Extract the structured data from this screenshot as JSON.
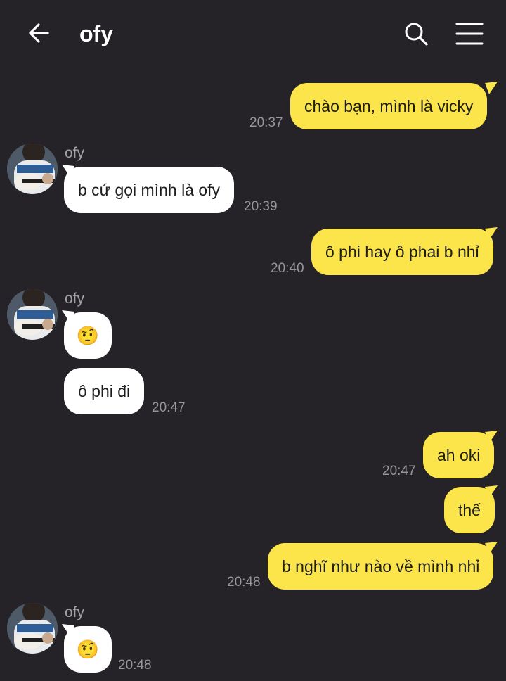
{
  "header": {
    "title": "ofy",
    "back_icon": "arrow-left-icon",
    "search_icon": "search-icon",
    "menu_icon": "hamburger-menu-icon"
  },
  "colors": {
    "background": "#262328",
    "outgoing_bubble": "#fbe54a",
    "incoming_bubble": "#ffffff",
    "timestamp": "#98969b"
  },
  "messages": [
    {
      "direction": "out",
      "text": "chào bạn, mình là vicky",
      "time": "20:37"
    },
    {
      "direction": "in",
      "sender": "ofy",
      "text": "b cứ gọi mình là ofy",
      "time": "20:39"
    },
    {
      "direction": "out",
      "text": "ô phi hay ô phai b nhỉ",
      "time": "20:40"
    },
    {
      "direction": "in",
      "sender": "ofy",
      "text": "🤨",
      "time": ""
    },
    {
      "direction": "in",
      "text": "ô phi đi",
      "time": "20:47"
    },
    {
      "direction": "out",
      "text": "ah oki",
      "time": "20:47"
    },
    {
      "direction": "out",
      "text": "thế",
      "time": ""
    },
    {
      "direction": "out",
      "text": "b nghĩ như nào về mình nhỉ",
      "time": "20:48"
    },
    {
      "direction": "in",
      "sender": "ofy",
      "text": "🤨",
      "time": "20:48"
    }
  ]
}
